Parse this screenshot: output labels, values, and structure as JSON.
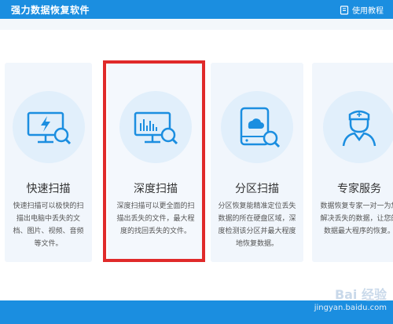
{
  "header": {
    "app_title": "强力数据恢复软件",
    "tutorial_label": "使用教程"
  },
  "cards": [
    {
      "title": "快速扫描",
      "desc": "快速扫描可以极快的扫描出电脑中丢失的文档、图片、视频、音频等文件。",
      "icon": "lightning-monitor-icon"
    },
    {
      "title": "深度扫描",
      "desc": "深度扫描可以更全面的扫描出丢失的文件，最大程度的找回丢失的文件。",
      "icon": "chart-monitor-icon"
    },
    {
      "title": "分区扫描",
      "desc": "分区恢复能精准定位丢失数据的所在硬盘区域，深度检测该分区并最大程度地恢复数据。",
      "icon": "cloud-drive-icon"
    },
    {
      "title": "专家服务",
      "desc": "数据恢复专家一对一为您解决丢失的数据，让您的数据最大程序的恢复。",
      "icon": "doctor-icon"
    }
  ],
  "watermark": {
    "logo": "Bai 经验",
    "url": "jingyan.baidu.com"
  },
  "colors": {
    "primary": "#1b8ee0",
    "card_bg": "#f1f6fc",
    "highlight": "#e02a2a"
  }
}
